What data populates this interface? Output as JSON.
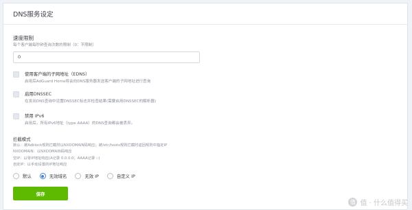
{
  "card": {
    "title": "DNS服务设定"
  },
  "rate_limit": {
    "title": "速度限制",
    "description": "每个客户端每秒钟查询次数的限制（0：不限制）",
    "value": "0"
  },
  "options": [
    {
      "label": "使用客户端的子网地址（EDNS）",
      "description": "启用后AdGuard Home将会向DNS服务器发送客户端的子网地址进行查询",
      "checked": false
    },
    {
      "label": "启用DNSSEC",
      "description": "在发出DNS查询中设置DNSSEC标志并检查结果(需要启用DNSSEC的解析器)",
      "checked": false
    },
    {
      "label": "禁用 IPv6",
      "description": "启用后，所有IPv6地址（type AAAA）的DNS查询都会被丢弃。",
      "checked": false
    }
  ],
  "blocking_mode": {
    "title": "拦截模式",
    "descriptions": [
      "默认：被Adblock规则拦截时以NXDOMAIN码响应；被/etc/hosts规则拦截时返回规则中指定IP",
      "NXDOMAIN：以NXDOMAIN码响应",
      "空IP：以零IP地址响应(A记录 0.0.0.0；AAAA记录 ::)",
      "自定IP：以手动设置的IP地址响应"
    ],
    "options": [
      "默认",
      "无效域名",
      "无效 IP",
      "自定义 IP"
    ],
    "selected": "无效域名"
  },
  "save_button": {
    "label": "保存"
  },
  "watermark": {
    "text": "值 · 什么值得买",
    "icon": "zhi-icon"
  },
  "colors": {
    "accent": "#467fcf",
    "save": "#5eba00",
    "checkbox": "#e4e7ec"
  }
}
